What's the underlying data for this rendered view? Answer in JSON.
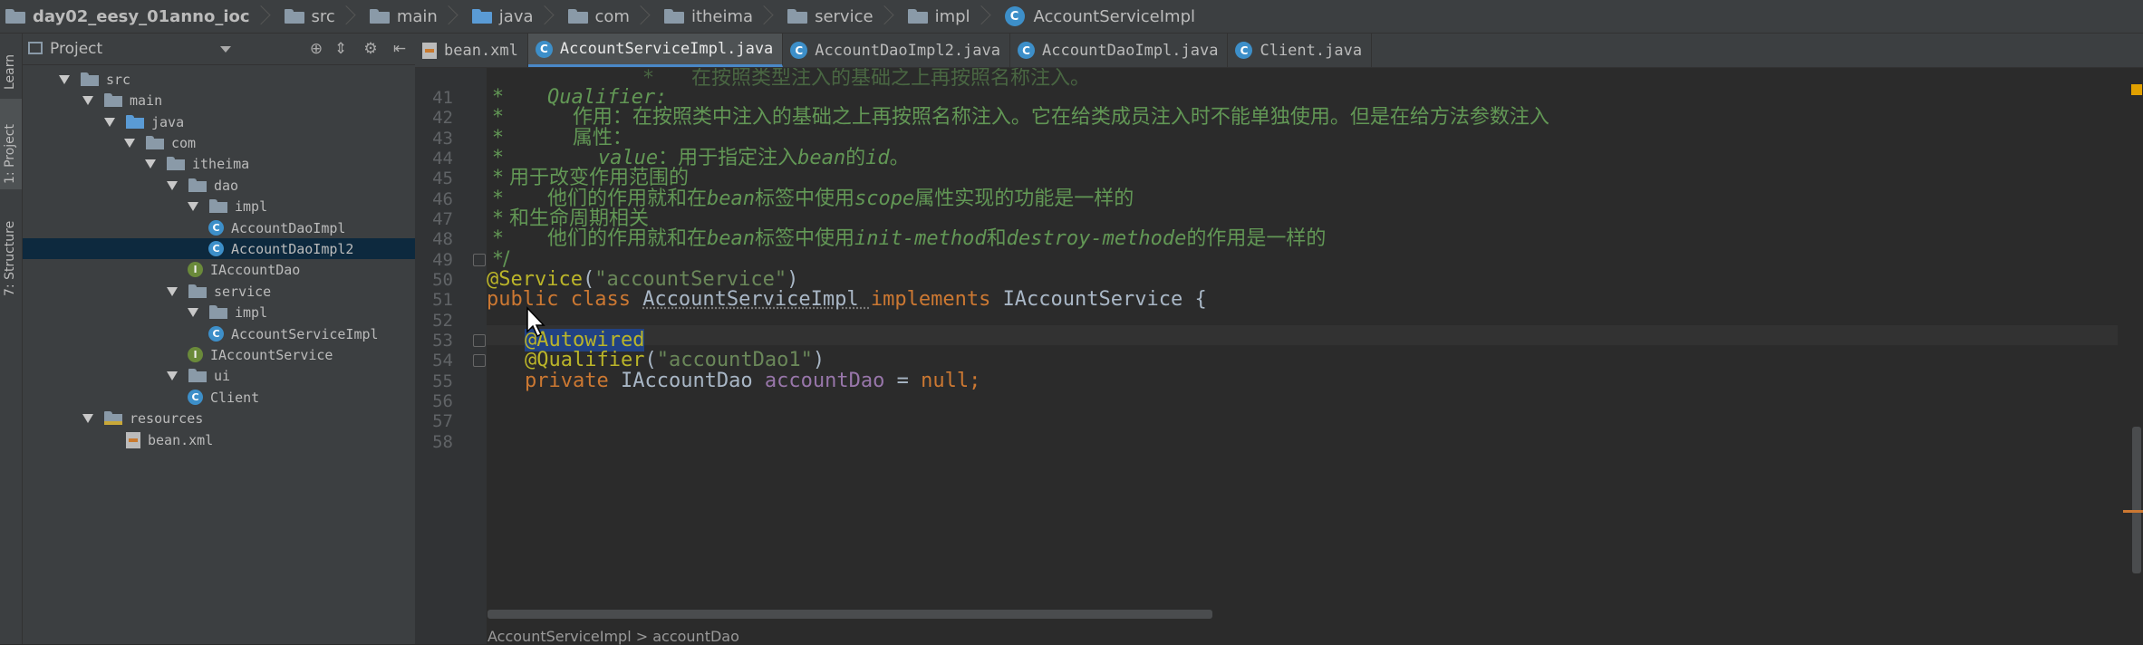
{
  "breadcrumb": [
    {
      "label": "day02_eesy_01anno_ioc",
      "kind": "project"
    },
    {
      "label": "src",
      "kind": "folder"
    },
    {
      "label": "main",
      "kind": "folder"
    },
    {
      "label": "java",
      "kind": "folder-blue"
    },
    {
      "label": "com",
      "kind": "folder"
    },
    {
      "label": "itheima",
      "kind": "folder"
    },
    {
      "label": "service",
      "kind": "folder"
    },
    {
      "label": "impl",
      "kind": "folder"
    },
    {
      "label": "AccountServiceImpl",
      "kind": "class"
    }
  ],
  "left_strip": {
    "learn": "Learn",
    "project": "1: Project",
    "structure": "7: Structure"
  },
  "project_panel": {
    "title": "Project",
    "tree": [
      {
        "label": "src",
        "level": 1,
        "expanded": true,
        "icon": "folder"
      },
      {
        "label": "main",
        "level": 2,
        "expanded": true,
        "icon": "folder"
      },
      {
        "label": "java",
        "level": 3,
        "expanded": true,
        "icon": "folder-blue"
      },
      {
        "label": "com",
        "level": 4,
        "expanded": true,
        "icon": "package"
      },
      {
        "label": "itheima",
        "level": 5,
        "expanded": true,
        "icon": "package"
      },
      {
        "label": "dao",
        "level": 6,
        "expanded": true,
        "icon": "package"
      },
      {
        "label": "impl",
        "level": 7,
        "expanded": true,
        "icon": "package"
      },
      {
        "label": "AccountDaoImpl",
        "level": 8,
        "icon": "class"
      },
      {
        "label": "AccountDaoImpl2",
        "level": 8,
        "icon": "class",
        "selected": true
      },
      {
        "label": "IAccountDao",
        "level": 7,
        "icon": "interface"
      },
      {
        "label": "service",
        "level": 6,
        "expanded": true,
        "icon": "package"
      },
      {
        "label": "impl",
        "level": 7,
        "expanded": true,
        "icon": "package"
      },
      {
        "label": "AccountServiceImpl",
        "level": 8,
        "icon": "class"
      },
      {
        "label": "IAccountService",
        "level": 7,
        "icon": "interface"
      },
      {
        "label": "ui",
        "level": 6,
        "expanded": true,
        "icon": "package"
      },
      {
        "label": "Client",
        "level": 7,
        "icon": "class-main"
      },
      {
        "label": "resources",
        "level": 3,
        "expanded": true,
        "icon": "resources"
      },
      {
        "label": "bean.xml",
        "level": 4,
        "icon": "xml"
      }
    ]
  },
  "editor_tabs": [
    {
      "label": "bean.xml",
      "icon": "xml"
    },
    {
      "label": "AccountServiceImpl.java",
      "icon": "class",
      "active": true
    },
    {
      "label": "AccountDaoImpl2.java",
      "icon": "class"
    },
    {
      "label": "AccountDaoImpl.java",
      "icon": "class"
    },
    {
      "label": "Client.java",
      "icon": "class-main"
    }
  ],
  "code": {
    "line_numbers": [
      "41",
      "42",
      "43",
      "44",
      "45",
      "46",
      "47",
      "48",
      "49",
      "50",
      "51",
      "52",
      "53",
      "54",
      "55",
      "56",
      "57",
      "58"
    ],
    "top_partial": "*      在按照类型注入的基础之上再按照名称注入。",
    "l41a": " *       ",
    "l41b": "Qualifier:",
    "l42": " *           作用：在按照类中注入的基础之上再按照名称注入。它在给类成员注入时不能单独使用。但是在给方法参数注入",
    "l43": " *           属性：",
    "l44a": " *               ",
    "l44b": "value",
    "l44c": "：用于指定注入",
    "l44d": "bean",
    "l44e": "的",
    "l44f": "id",
    "l44g": "。",
    "l45": " * 用于改变作用范围的",
    "l46a": " *       他们的作用就和在",
    "l46b": "bean",
    "l46c": "标签中使用",
    "l46d": "scope",
    "l46e": "属性实现的功能是一样的",
    "l47": " * 和生命周期相关",
    "l48a": " *       他们的作用就和在",
    "l48b": "bean",
    "l48c": "标签中使用",
    "l48d": "init-method",
    "l48e": "和",
    "l48f": "destroy-methode",
    "l48g": "的作用是一样的",
    "l49": " */",
    "l50a": "@Service",
    "l50b": "(",
    "l50c": "\"accountService\"",
    "l50d": ")",
    "l51a": "public class ",
    "l51b": "AccountServiceImpl ",
    "l51c": "implements ",
    "l51d": "IAccountService {",
    "l53": "@Autowired",
    "l54a": "@Qualifier",
    "l54b": "(",
    "l54c": "\"accountDao1\"",
    "l54d": ")",
    "l55a": "private ",
    "l55b": "IAccountDao ",
    "l55c": "accountDao",
    "l55d": " = ",
    "l55e": "null",
    "l55f": ";"
  },
  "status_breadcrumb": "AccountServiceImpl > accountDao"
}
